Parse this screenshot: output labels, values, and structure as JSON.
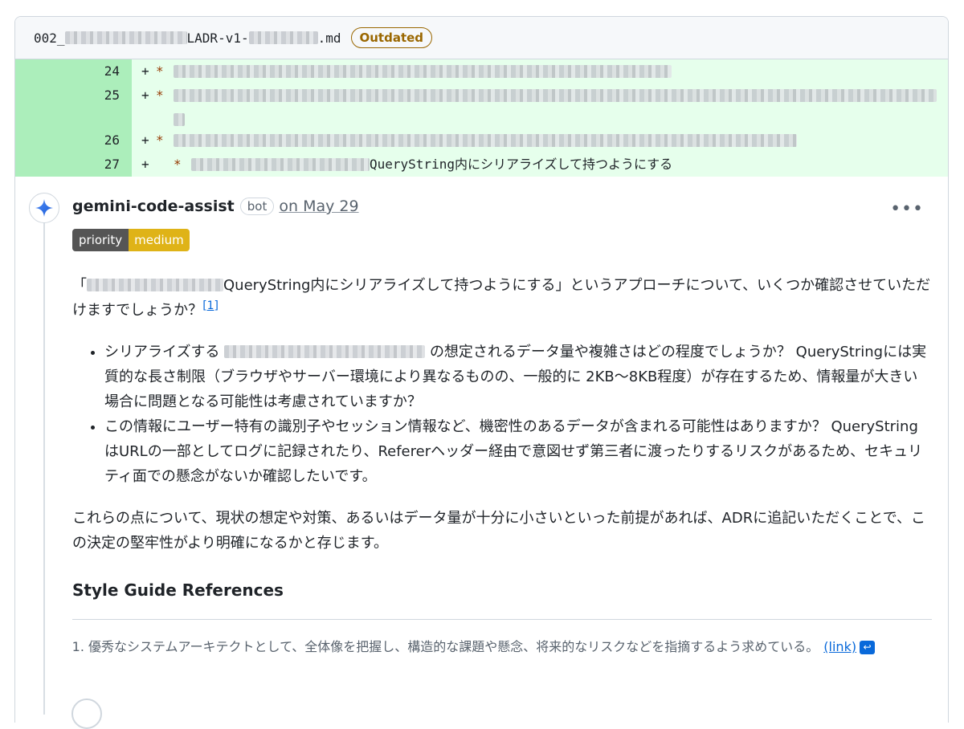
{
  "file": {
    "name_prefix": "002_",
    "name_mid": "LADR-v1-",
    "name_suffix": ".md",
    "status_badge": "Outdated"
  },
  "diff": {
    "lines": [
      {
        "num": "24",
        "sign": "+",
        "marker": "*",
        "text": ""
      },
      {
        "num": "25",
        "sign": "+",
        "marker": "*",
        "text": ""
      },
      {
        "num": "26",
        "sign": "+",
        "marker": "*",
        "text": ""
      },
      {
        "num": "27",
        "sign": "+",
        "marker": "*",
        "text": "QueryString内にシリアライズして持つようにする"
      }
    ]
  },
  "comment": {
    "author": "gemini-code-assist",
    "bot_label": "bot",
    "date": "on May 29",
    "menu_icon": "kebab-horizontal-icon",
    "priority_label": "priority",
    "priority_value": "medium",
    "intro_open": "「",
    "intro_rest": "QueryString内にシリアライズして持つようにする」というアプローチについて、いくつか確認させていただけますでしょうか？",
    "ref_marker": "[1]",
    "bullet1_a": "シリアライズする",
    "bullet1_b": "の想定されるデータ量や複雑さはどの程度でしょうか？ QueryStringには実質的な長さ制限（ブラウザやサーバー環境により異なるものの、一般的に 2KB〜8KB程度）が存在するため、情報量が大きい場合に問題となる可能性は考慮されていますか？",
    "bullet2": "この情報にユーザー特有の識別子やセッション情報など、機密性のあるデータが含まれる可能性はありますか？ QueryString はURLの一部としてログに記録されたり、Refererヘッダー経由で意図せず第三者に渡ったりするリスクがあるため、セキュリティ面での懸念がないか確認したいです。",
    "closing": "これらの点について、現状の想定や対策、あるいはデータ量が十分に小さいといった前提があれば、ADRに追記いただくことで、この決定の堅牢性がより明確になるかと存じます。",
    "style_guide_heading": "Style Guide References",
    "footnote_text": "優秀なシステムアーキテクトとして、全体像を把握し、構造的な課題や懸念、将来的なリスクなどを指摘するよう求めている。",
    "footnote_link": "(link)",
    "footnote_backref": "↩"
  },
  "colors": {
    "added_bg": "#e6ffec",
    "added_gutter": "#aceebb",
    "outdated": "#9a6700",
    "priority_medium": "#dfb317",
    "link": "#0969da"
  }
}
